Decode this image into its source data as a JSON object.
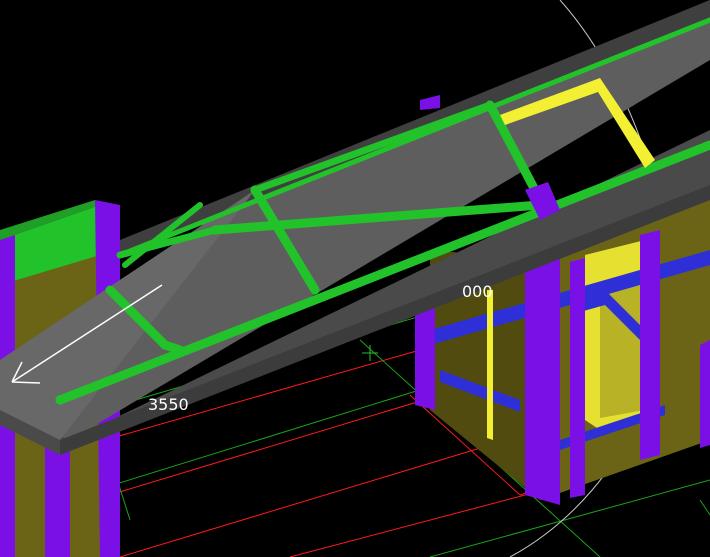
{
  "viewport": {
    "background": "#000000",
    "dimension_labels": [
      "000",
      "3550"
    ]
  },
  "colors": {
    "roof_face": "#5e5e5e",
    "roof_face_dark": "#3c3c3c",
    "brace_green": "#22c32a",
    "selected_yellow": "#f3f033",
    "column_purple": "#7a10e6",
    "wall_olive": "#6b6417",
    "wall_olive_dark": "#514b10",
    "frame_blue": "#2f2fd8",
    "grid_red": "#ff1a1a",
    "grid_green": "#1aa31a"
  },
  "icons": {
    "view_direction": "arrow-left-down-icon",
    "orbit_guide": "orbit-circle-icon"
  }
}
